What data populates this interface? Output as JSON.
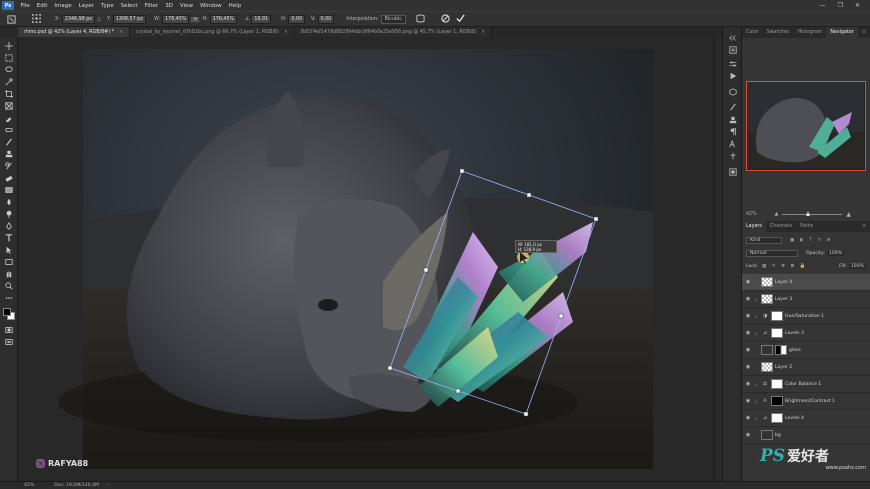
{
  "app": {
    "logo": "Ps"
  },
  "menu": [
    "File",
    "Edit",
    "Image",
    "Layer",
    "Type",
    "Select",
    "Filter",
    "3D",
    "View",
    "Window",
    "Help"
  ],
  "window_controls": {
    "minimize": "—",
    "maximize": "❐",
    "close": "✕"
  },
  "options": {
    "x_label": "X:",
    "x_value": "2346,98 px",
    "y_label": "Y:",
    "y_value": "1308,57 px",
    "w_label": "W:",
    "w_value": "176,45%",
    "h_label": "H:",
    "h_value": "176,45%",
    "angle_value": "19,91",
    "h_skew_label": "H:",
    "h_skew_value": "0,00",
    "v_skew_label": "V:",
    "v_skew_value": "0,00",
    "interp_label": "Interpolation:",
    "interp_value": "Bicubic"
  },
  "tabs": [
    {
      "label": "rhino.psd @ 42% (Layer 4, RGB/8#) *",
      "close": "×"
    },
    {
      "label": "crystal_by_wyonet_d7k01bu.png @ 66,7% (Layer 1, RGB/8)",
      "close": "×"
    },
    {
      "label": "8d574ef1479d882894dbc9f64b0e25e956.png @ 45,7% (Layer 1, RGB/8)",
      "close": "×"
    }
  ],
  "transform_tooltip": {
    "w": "W: 181,0 px",
    "h": "H: 138,9 px"
  },
  "canvas_watermark": "RAFYA88",
  "right_panel": {
    "tabs": [
      "Color",
      "Swatches",
      "Histogram",
      "Navigator"
    ],
    "nav_zoom": "42%",
    "layers_tabs": [
      "Layers",
      "Channels",
      "Paths"
    ],
    "search_kind": "Kind",
    "blend_mode": "Normal",
    "opacity_label": "Opacity:",
    "opacity_value": "100%",
    "lock_label": "Lock:",
    "fill_label": "Fill:",
    "fill_value": "100%",
    "layers": [
      {
        "name": "Layer 4",
        "thumb": "chk",
        "selected": true
      },
      {
        "name": "Layer 3",
        "thumb": "chk",
        "clip": true
      },
      {
        "name": "Hue/Saturation 1",
        "adj": "◑",
        "clip": true
      },
      {
        "name": "Levels 3",
        "adj": "⊿",
        "clip": true
      },
      {
        "name": "glass",
        "thumb": "dark",
        "mask": true
      },
      {
        "name": "Layer 2",
        "thumb": "chk"
      },
      {
        "name": "Color Balance 1",
        "adj": "⚖",
        "clip": true
      },
      {
        "name": "Brightness/Contrast 1",
        "adj": "☼",
        "clip": true
      },
      {
        "name": "Levels 4",
        "adj": "⊿",
        "clip": true
      },
      {
        "name": "bg",
        "thumb": "dark"
      }
    ]
  },
  "status": {
    "zoom": "42%",
    "doc": "Doc: 19,0M/140,4M"
  },
  "site_watermark": {
    "logo": "PS",
    "cn": "爱好者",
    "url": "www.psahz.com"
  }
}
